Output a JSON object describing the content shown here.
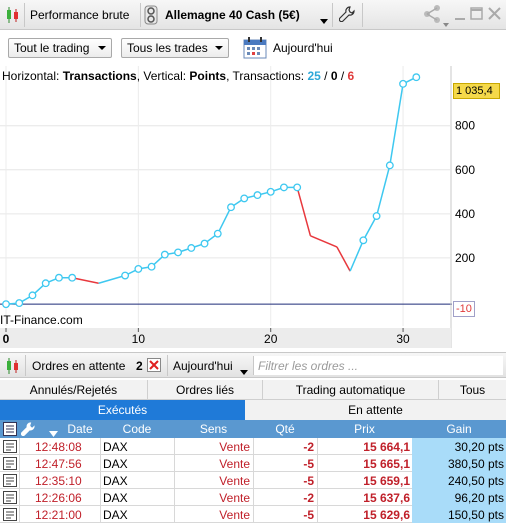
{
  "toolbar": {
    "view_label": "Performance brute",
    "instrument_label": "Allemagne 40 Cash (5€)",
    "icons": [
      "candlestick-icon",
      "link-icon",
      "wrench-icon",
      "share-icon",
      "minimize-icon",
      "maximize-icon",
      "close-icon"
    ]
  },
  "filters": {
    "trading_select": "Tout le trading",
    "trades_select": "Tous les trades",
    "date_label": "Aujourd'hui"
  },
  "chart_info": {
    "horizontal_label": "Horizontal: ",
    "horizontal_value": "Transactions",
    "vertical_label": ", Vertical: ",
    "vertical_value": "Points",
    "transactions_label": ", Transactions: ",
    "wins": "25",
    "sep1": " / ",
    "neutral": "0",
    "sep2": " / ",
    "losses": "6"
  },
  "chart_data": {
    "type": "line",
    "xlabel": "",
    "ylabel": "",
    "x_ticks": [
      "0",
      "10",
      "20",
      "30"
    ],
    "y_ticks": [
      "200",
      "400",
      "600",
      "800"
    ],
    "xlim": [
      0,
      34
    ],
    "ylim": [
      -100,
      1080
    ],
    "current_value_label": "1 035,4",
    "min_value_label": "-10",
    "points": [
      [
        0,
        -10
      ],
      [
        1,
        -5
      ],
      [
        2,
        30
      ],
      [
        3,
        85
      ],
      [
        4,
        110
      ],
      [
        5,
        110
      ],
      [
        7,
        85
      ],
      [
        9,
        120
      ],
      [
        10,
        150
      ],
      [
        11,
        160
      ],
      [
        12,
        215
      ],
      [
        13,
        225
      ],
      [
        14,
        245
      ],
      [
        15,
        265
      ],
      [
        16,
        310
      ],
      [
        17,
        430
      ],
      [
        18,
        470
      ],
      [
        19,
        485
      ],
      [
        20,
        500
      ],
      [
        21,
        520
      ],
      [
        22,
        520
      ],
      [
        23,
        300
      ],
      [
        25,
        250
      ],
      [
        26,
        140
      ],
      [
        27,
        280
      ],
      [
        28,
        390
      ],
      [
        29,
        620
      ],
      [
        30,
        990
      ],
      [
        31,
        1020
      ]
    ],
    "segment_colors": {
      "up": "#3ec8f0",
      "down": "#e8383d"
    }
  },
  "watermark": "IT-Finance.com",
  "orders": {
    "title": "Ordres en attente",
    "count": "2",
    "date_select": "Aujourd'hui",
    "filter_placeholder": "Filtrer les ordres ..."
  },
  "tabs_row1": [
    "Annulés/Rejetés",
    "Ordres liés",
    "Trading automatique",
    "Tous"
  ],
  "tabs_row2": [
    "Exécutés",
    "En attente"
  ],
  "table": {
    "headers": [
      "Date",
      "Code",
      "Sens",
      "Qté",
      "Prix",
      "Gain"
    ],
    "rows": [
      {
        "time": "12:48:08",
        "code": "DAX",
        "side": "Vente",
        "qty": "-2",
        "price": "15 664,1",
        "gain": "30,20 pts"
      },
      {
        "time": "12:47:56",
        "code": "DAX",
        "side": "Vente",
        "qty": "-5",
        "price": "15 665,1",
        "gain": "380,50 pts"
      },
      {
        "time": "12:35:10",
        "code": "DAX",
        "side": "Vente",
        "qty": "-5",
        "price": "15 659,1",
        "gain": "240,50 pts"
      },
      {
        "time": "12:26:06",
        "code": "DAX",
        "side": "Vente",
        "qty": "-2",
        "price": "15 637,6",
        "gain": "96,20 pts"
      },
      {
        "time": "12:21:00",
        "code": "DAX",
        "side": "Vente",
        "qty": "-5",
        "price": "15 629,6",
        "gain": "150,50 pts"
      }
    ]
  },
  "colors": {
    "accent_blue": "#1f7ad8",
    "header_blue": "#5a98d0",
    "gain_cell": "#a9dcf9",
    "sell_red": "#c0202a",
    "badge_yellow": "#f5d94a"
  }
}
